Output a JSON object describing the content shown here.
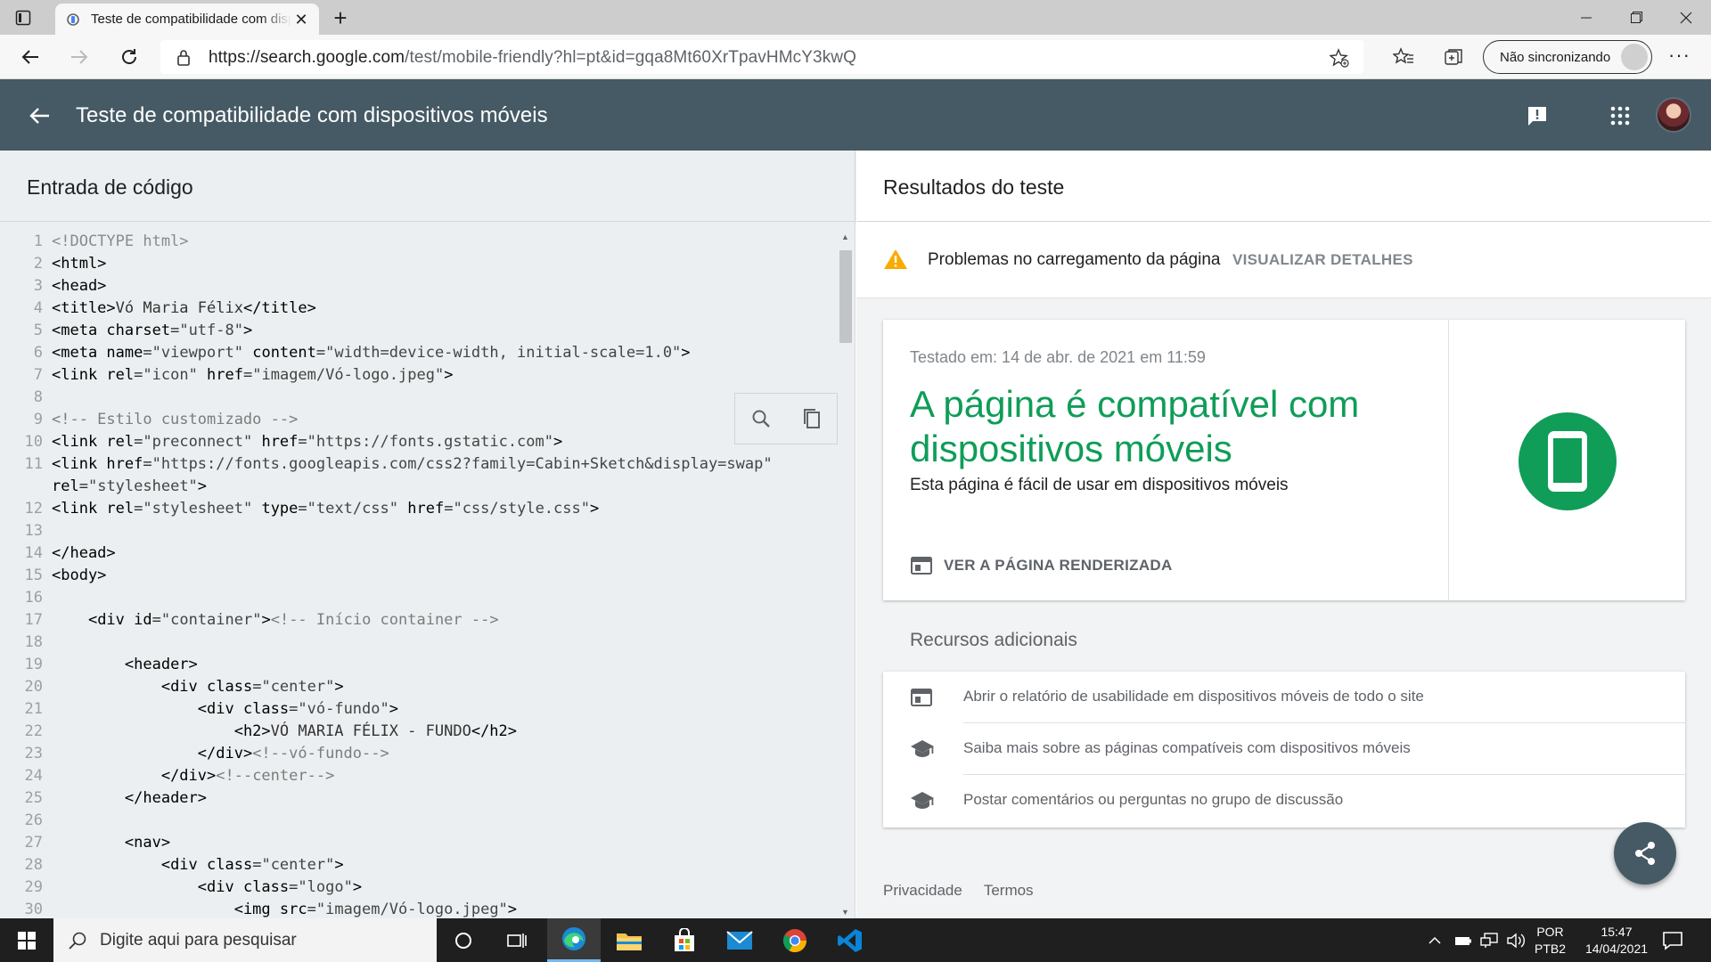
{
  "browser": {
    "tab_title": "Teste de compatibilidade com dispositivos móveis",
    "url_host": "https://search.google.com",
    "url_path": "/test/mobile-friendly?hl=pt&id=gqa8Mt60XrTpavHMcY3kwQ",
    "sync_label": "Não sincronizando",
    "more_label": "···"
  },
  "appbar": {
    "title": "Teste de compatibilidade com dispositivos móveis"
  },
  "code_panel": {
    "title": "Entrada de código",
    "lines": [
      [
        [
          "doc",
          "<!DOCTYPE html>"
        ]
      ],
      [
        [
          "tag",
          "<html>"
        ]
      ],
      [
        [
          "tag",
          "<head>"
        ]
      ],
      [
        [
          "tag",
          "<title>"
        ],
        [
          "txt",
          "Vó Maria Félix"
        ],
        [
          "tag",
          "</title>"
        ]
      ],
      [
        [
          "tag",
          "<meta "
        ],
        [
          "attr",
          "charset"
        ],
        [
          "txt",
          "="
        ],
        [
          "val",
          "\"utf-8\""
        ],
        [
          "tag",
          ">"
        ]
      ],
      [
        [
          "tag",
          "<meta "
        ],
        [
          "attr",
          "name"
        ],
        [
          "txt",
          "="
        ],
        [
          "val",
          "\"viewport\" "
        ],
        [
          "attr",
          "content"
        ],
        [
          "txt",
          "="
        ],
        [
          "val",
          "\"width=device-width, initial-scale=1.0\""
        ],
        [
          "tag",
          ">"
        ]
      ],
      [
        [
          "tag",
          "<link "
        ],
        [
          "attr",
          "rel"
        ],
        [
          "txt",
          "="
        ],
        [
          "val",
          "\"icon\" "
        ],
        [
          "attr",
          "href"
        ],
        [
          "txt",
          "="
        ],
        [
          "val",
          "\"imagem/Vó-logo.jpeg\""
        ],
        [
          "tag",
          ">"
        ]
      ],
      [],
      [
        [
          "com",
          "<!-- Estilo customizado -->"
        ]
      ],
      [
        [
          "tag",
          "<link "
        ],
        [
          "attr",
          "rel"
        ],
        [
          "txt",
          "="
        ],
        [
          "val",
          "\"preconnect\" "
        ],
        [
          "attr",
          "href"
        ],
        [
          "txt",
          "="
        ],
        [
          "val",
          "\"https://fonts.gstatic.com\""
        ],
        [
          "tag",
          ">"
        ]
      ],
      [
        [
          "tag",
          "<link "
        ],
        [
          "attr",
          "href"
        ],
        [
          "txt",
          "="
        ],
        [
          "val",
          "\"https://fonts.googleapis.com/css2?family=Cabin+Sketch&display=swap\""
        ]
      ],
      [
        [
          "attr",
          "rel"
        ],
        [
          "txt",
          "="
        ],
        [
          "val",
          "\"stylesheet\""
        ],
        [
          "tag",
          ">"
        ]
      ],
      [
        [
          "tag",
          "<link "
        ],
        [
          "attr",
          "rel"
        ],
        [
          "txt",
          "="
        ],
        [
          "val",
          "\"stylesheet\" "
        ],
        [
          "attr",
          "type"
        ],
        [
          "txt",
          "="
        ],
        [
          "val",
          "\"text/css\" "
        ],
        [
          "attr",
          "href"
        ],
        [
          "txt",
          "="
        ],
        [
          "val",
          "\"css/style.css\""
        ],
        [
          "tag",
          ">"
        ]
      ],
      [],
      [
        [
          "tag",
          "</head>"
        ]
      ],
      [
        [
          "tag",
          "<body>"
        ]
      ],
      [],
      [
        [
          "txt",
          "    "
        ],
        [
          "tag",
          "<div "
        ],
        [
          "attr",
          "id"
        ],
        [
          "txt",
          "="
        ],
        [
          "val",
          "\"container\""
        ],
        [
          "tag",
          ">"
        ],
        [
          "com",
          "<!-- Início container -->"
        ]
      ],
      [],
      [
        [
          "txt",
          "        "
        ],
        [
          "tag",
          "<header>"
        ]
      ],
      [
        [
          "txt",
          "            "
        ],
        [
          "tag",
          "<div "
        ],
        [
          "attr",
          "class"
        ],
        [
          "txt",
          "="
        ],
        [
          "val",
          "\"center\""
        ],
        [
          "tag",
          ">"
        ]
      ],
      [
        [
          "txt",
          "                "
        ],
        [
          "tag",
          "<div "
        ],
        [
          "attr",
          "class"
        ],
        [
          "txt",
          "="
        ],
        [
          "val",
          "\"vó-fundo\""
        ],
        [
          "tag",
          ">"
        ]
      ],
      [
        [
          "txt",
          "                    "
        ],
        [
          "tag",
          "<h2>"
        ],
        [
          "txt",
          "VÓ MARIA FÉLIX - FUNDO"
        ],
        [
          "tag",
          "</h2>"
        ]
      ],
      [
        [
          "txt",
          "                "
        ],
        [
          "tag",
          "</div>"
        ],
        [
          "com",
          "<!--vó-fundo-->"
        ]
      ],
      [
        [
          "txt",
          "            "
        ],
        [
          "tag",
          "</div>"
        ],
        [
          "com",
          "<!--center-->"
        ]
      ],
      [
        [
          "txt",
          "        "
        ],
        [
          "tag",
          "</header>"
        ]
      ],
      [],
      [
        [
          "txt",
          "        "
        ],
        [
          "tag",
          "<nav>"
        ]
      ],
      [
        [
          "txt",
          "            "
        ],
        [
          "tag",
          "<div "
        ],
        [
          "attr",
          "class"
        ],
        [
          "txt",
          "="
        ],
        [
          "val",
          "\"center\""
        ],
        [
          "tag",
          ">"
        ]
      ],
      [
        [
          "txt",
          "                "
        ],
        [
          "tag",
          "<div "
        ],
        [
          "attr",
          "class"
        ],
        [
          "txt",
          "="
        ],
        [
          "val",
          "\"logo\""
        ],
        [
          "tag",
          ">"
        ]
      ],
      [
        [
          "txt",
          "                    "
        ],
        [
          "tag",
          "<img "
        ],
        [
          "attr",
          "src"
        ],
        [
          "txt",
          "="
        ],
        [
          "val",
          "\"imagem/Vó-logo.jpeg\""
        ],
        [
          "tag",
          ">"
        ]
      ]
    ]
  },
  "results": {
    "title": "Resultados do teste",
    "warning_text": "Problemas no carregamento da página",
    "warning_link": "VISUALIZAR DETALHES",
    "tested_at": "Testado em: 14 de abr. de 2021 em 11:59",
    "verdict": "A página é compatível com dispositivos móveis",
    "verdict_sub": "Esta página é fácil de usar em dispositivos móveis",
    "render_link": "VER A PÁGINA RENDERIZADA",
    "resources_title": "Recursos adicionais",
    "resources": [
      {
        "icon": "report-icon",
        "label": "Abrir o relatório de usabilidade em dispositivos móveis de todo o site"
      },
      {
        "icon": "school-icon",
        "label": "Saiba mais sobre as páginas compatíveis com dispositivos móveis"
      },
      {
        "icon": "school-icon",
        "label": "Postar comentários ou perguntas no grupo de discussão"
      }
    ],
    "footer_privacy": "Privacidade",
    "footer_terms": "Termos"
  },
  "taskbar": {
    "search_placeholder": "Digite aqui para pesquisar",
    "lang_top": "POR",
    "lang_bottom": "PTB2",
    "time": "15:47",
    "date": "14/04/2021"
  },
  "colors": {
    "appbar": "#455a64",
    "success_green": "#0f9d58",
    "warning_yellow": "#f9ab00"
  }
}
